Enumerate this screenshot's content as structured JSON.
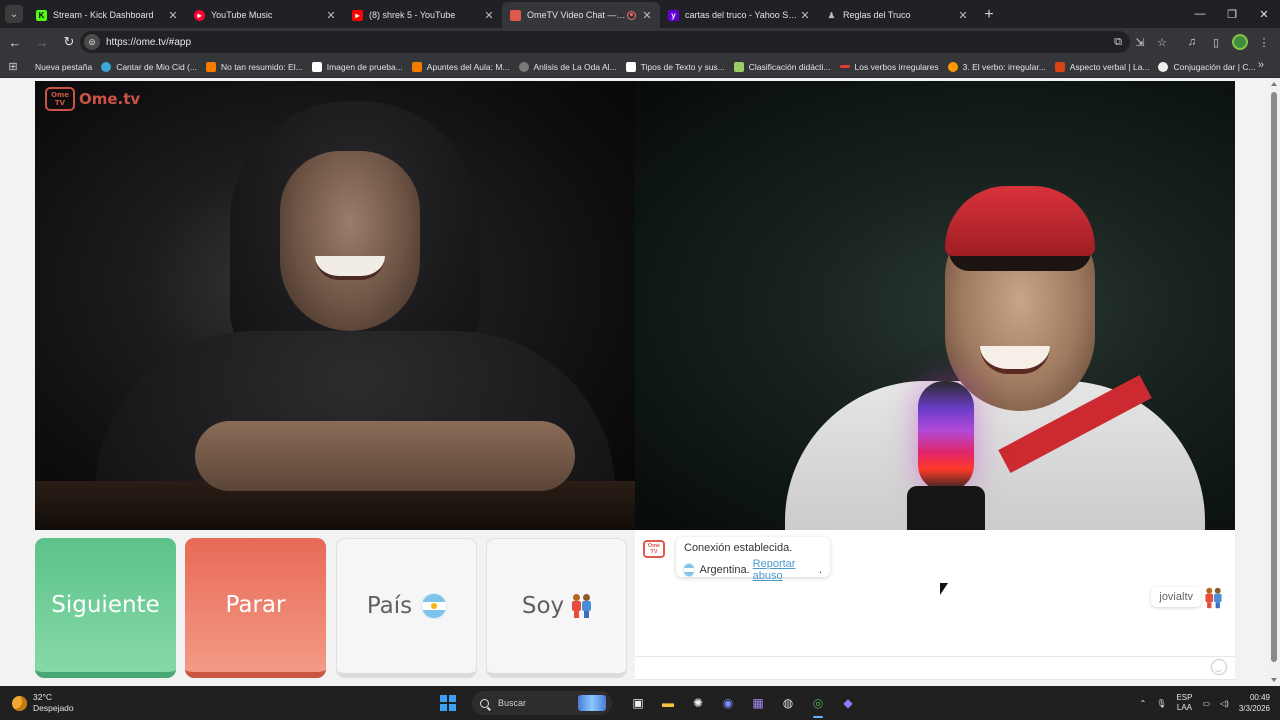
{
  "browser": {
    "tabs": [
      {
        "title": "Stream - Kick Dashboard",
        "icon": "kick-icon",
        "color": "#53fc18",
        "active": false
      },
      {
        "title": "YouTube Music",
        "icon": "youtube-music-icon",
        "color": "#ff0033",
        "active": false
      },
      {
        "title": "(8) shrek 5 - YouTube",
        "icon": "youtube-icon",
        "color": "#ff0000",
        "active": false
      },
      {
        "title": "OmeTV Video Chat — Ome",
        "icon": "ometv-icon",
        "color": "#e05a4b",
        "active": true,
        "recording": true
      },
      {
        "title": "cartas del truco - Yahoo Search",
        "icon": "yahoo-icon",
        "color": "#6001d2",
        "active": false
      },
      {
        "title": "Reglas del Truco",
        "icon": "page-icon",
        "color": "#888888",
        "active": false
      }
    ],
    "url": "https://ome.tv/#app",
    "bookmarks": [
      {
        "label": "Nueva pestaña",
        "color": "#35363a"
      },
      {
        "label": "Cantar de Mio Cid (...",
        "color": "#3aa7d8"
      },
      {
        "label": "No tan resumido: El...",
        "color": "#f57c00"
      },
      {
        "label": "Imagen de prueba...",
        "color": "#ffffff"
      },
      {
        "label": "Apuntes del Aula: M...",
        "color": "#f57c00"
      },
      {
        "label": "Anlisis de La Oda Al...",
        "color": "#7a7a7a"
      },
      {
        "label": "Tipos de Texto y sus...",
        "color": "#ffffff"
      },
      {
        "label": "Clasificación didácti...",
        "color": "#9ccc65"
      },
      {
        "label": "Los verbos irregulares",
        "color": "#e53935"
      },
      {
        "label": "3. El verbo: irregular...",
        "color": "#ff9800"
      },
      {
        "label": "Aspecto verbal | La...",
        "color": "#d84315"
      },
      {
        "label": "Conjugación dar | C...",
        "color": "#eeeeee"
      }
    ]
  },
  "app": {
    "logo_text": "Ome.tv",
    "logo_badge": "Ome TV",
    "buttons": {
      "next": "Siguiente",
      "stop": "Parar",
      "country": "País",
      "gender": "Soy"
    },
    "chat": {
      "connection_msg": "Conexión establecida.",
      "country": "Argentina.",
      "report_link": "Reportar abuso",
      "report_suffix": ".",
      "username": "jovialtv"
    }
  },
  "taskbar": {
    "weather_temp": "32°C",
    "weather_desc": "Despejado",
    "search_placeholder": "Buscar",
    "lang_top": "ESP",
    "lang_bottom": "LAA",
    "time": "00:49",
    "date": "3/3/2026"
  }
}
